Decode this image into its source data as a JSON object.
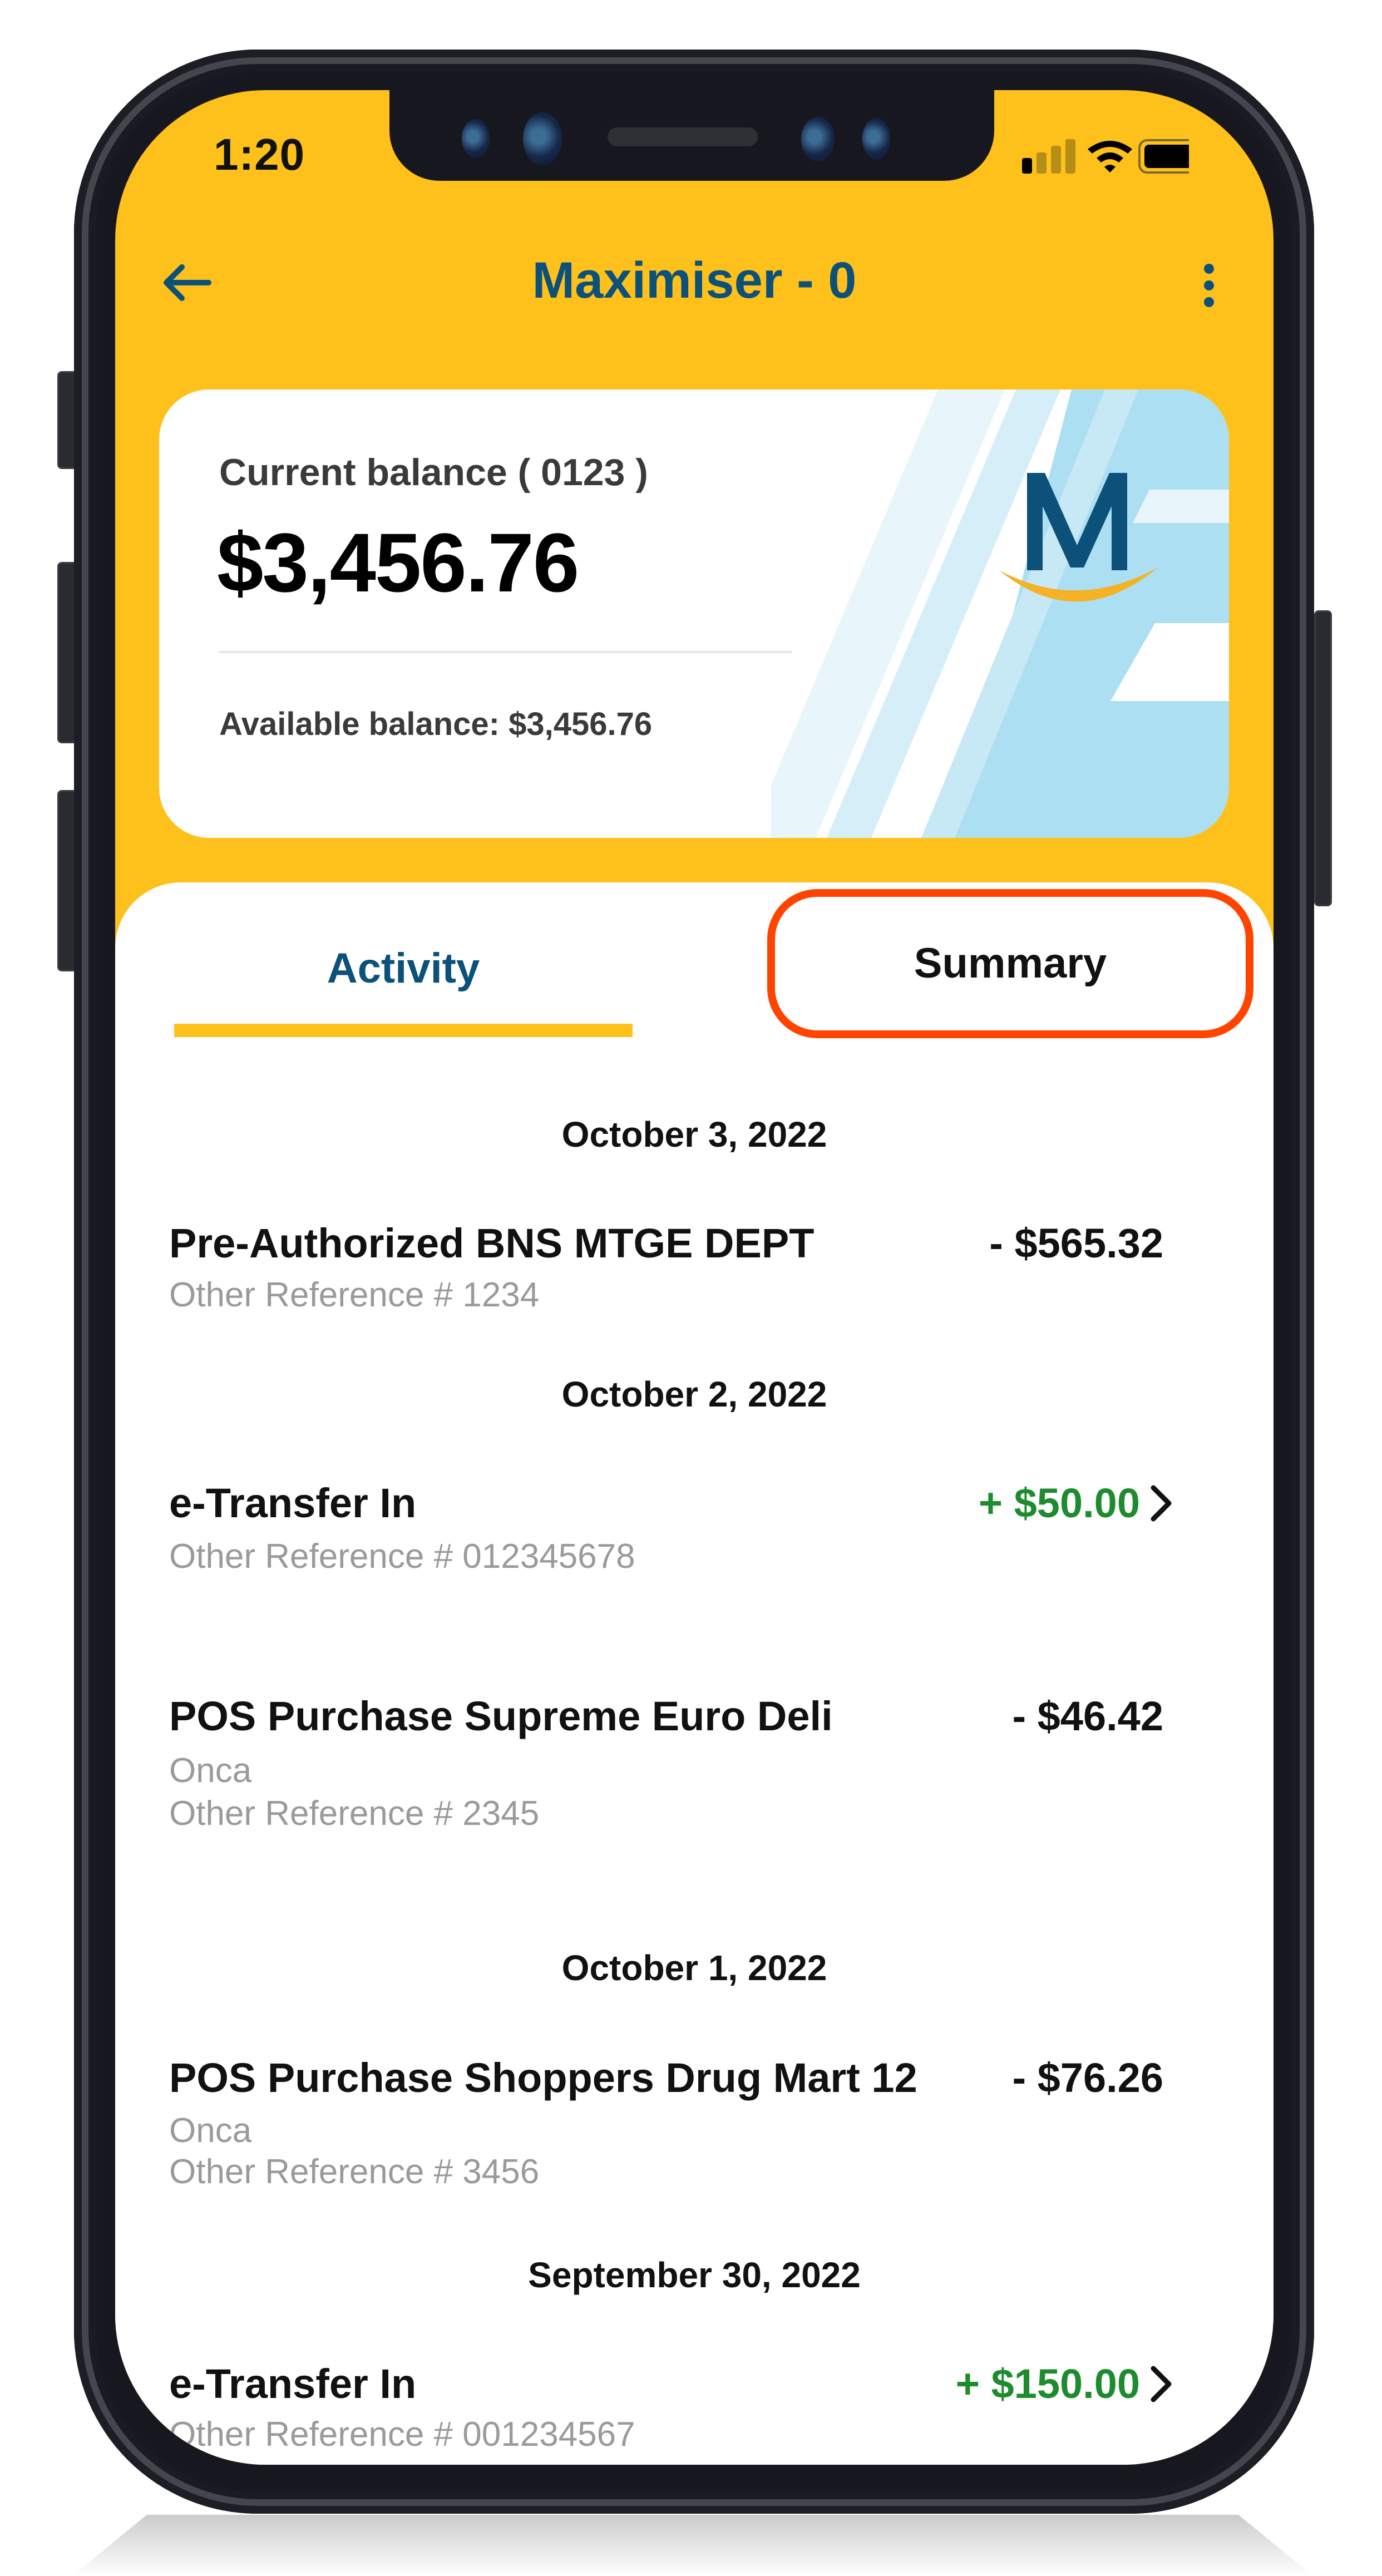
{
  "status_bar": {
    "time": "1:20",
    "signal_icon": "cellular-signal-icon",
    "signal_bars_active": 1,
    "signal_bars_total": 4,
    "wifi_icon": "wifi-icon",
    "battery_icon": "battery-icon",
    "battery_level": 0.9
  },
  "header": {
    "back_icon": "arrow-left-icon",
    "title": "Maximiser - 0",
    "more_icon": "more-vertical-icon"
  },
  "balance_card": {
    "current_label": "Current balance ( 0123 )",
    "current_balance": "$3,456.76",
    "available_label": "Available balance: $3,456.76",
    "logo": "maximiser-m-logo",
    "logo_letter": "M"
  },
  "tabs": [
    {
      "label": "Activity",
      "active": true
    },
    {
      "label": "Summary",
      "active": false,
      "highlighted": true
    }
  ],
  "activity": [
    {
      "date": "October 3, 2022",
      "transactions": [
        {
          "title": "Pre-Authorized BNS MTGE DEPT",
          "lines": [
            "Other Reference # 1234"
          ],
          "amount": "- $565.32",
          "type": "debit",
          "has_chevron": false
        }
      ]
    },
    {
      "date": "October 2, 2022",
      "transactions": [
        {
          "title": "e-Transfer In",
          "lines": [
            "Other Reference # 012345678"
          ],
          "amount": "+ $50.00",
          "type": "credit",
          "has_chevron": true
        },
        {
          "title": "POS Purchase Supreme Euro Deli",
          "lines": [
            "Onca",
            "Other Reference # 2345"
          ],
          "amount": "- $46.42",
          "type": "debit",
          "has_chevron": false
        }
      ]
    },
    {
      "date": "October 1, 2022",
      "transactions": [
        {
          "title": "POS Purchase Shoppers Drug Mart 12",
          "lines": [
            "Onca",
            "Other Reference # 3456"
          ],
          "amount": "- $76.26",
          "type": "debit",
          "has_chevron": false
        }
      ]
    },
    {
      "date": "September 30, 2022",
      "transactions": [
        {
          "title": "e-Transfer In",
          "lines": [
            "Other Reference # 001234567"
          ],
          "amount": "+ $150.00",
          "type": "credit",
          "has_chevron": true
        }
      ]
    }
  ],
  "colors": {
    "brand_yellow": "#FEC01B",
    "brand_blue": "#0B5179",
    "credit_green": "#1E8C2E",
    "highlight_orange": "#FF4400",
    "text_gray": "#9A9A9A"
  }
}
